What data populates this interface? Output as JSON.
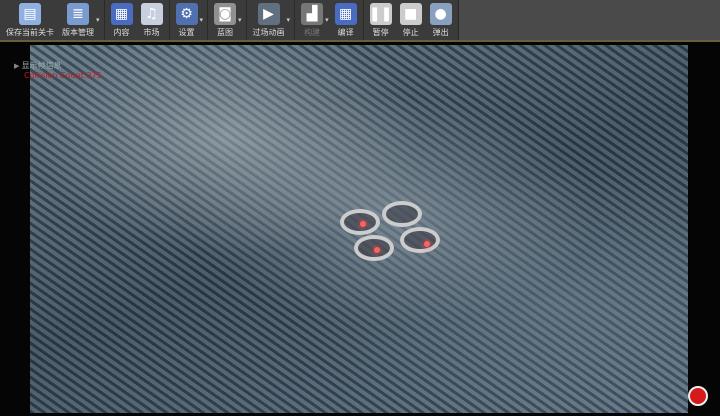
{
  "toolbar": {
    "items": [
      {
        "label": "保存当前关卡",
        "icon": "save-icon",
        "color": "#8fb0e0"
      },
      {
        "label": "版本管理",
        "icon": "source-control-icon",
        "color": "#7a9bd0",
        "dropdown": true
      },
      {
        "label": "内容",
        "icon": "content-icon",
        "color": "#4a6cc0"
      },
      {
        "label": "市场",
        "icon": "marketplace-icon",
        "color": "#c8d0e0"
      },
      {
        "label": "设置",
        "icon": "settings-icon",
        "color": "#5070b0",
        "dropdown": true
      },
      {
        "label": "蓝图",
        "icon": "blueprint-icon",
        "color": "#909090",
        "dropdown": true
      },
      {
        "label": "过场动画",
        "icon": "cinematics-icon",
        "color": "#607080",
        "dropdown": true
      },
      {
        "label": "构建",
        "icon": "build-icon",
        "color": "#777",
        "dropdown": true,
        "disabled": true
      },
      {
        "label": "编译",
        "icon": "compile-icon",
        "color": "#4a6cc0"
      },
      {
        "label": "暂停",
        "icon": "pause-icon",
        "color": "#ccc"
      },
      {
        "label": "停止",
        "icon": "stop-icon",
        "color": "#ccc"
      },
      {
        "label": "弹出",
        "icon": "eject-icon",
        "color": "#8aa0c0"
      }
    ]
  },
  "viewport": {
    "overlay_line1": "显示帧信息",
    "overlay_line2": "Collision Count:375",
    "record_icon": "record-icon",
    "record_color": "#d41a1a"
  }
}
